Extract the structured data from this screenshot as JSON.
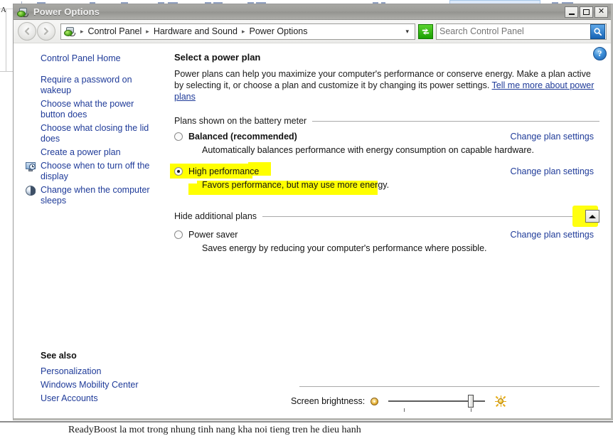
{
  "background": {
    "left_letter": "A",
    "bottom_text": "ReadyBoost la mot trong nhung tinh nang kha noi tieng tren he dieu hanh"
  },
  "window": {
    "title": "Power Options",
    "icon": "power-plug-icon",
    "minimize_label": "_",
    "maximize_label": "□",
    "close_label": "✕"
  },
  "toolbar": {
    "back_label": "Back",
    "forward_label": "Forward",
    "breadcrumbs": [
      "Control Panel",
      "Hardware and Sound",
      "Power Options"
    ],
    "breadcrumb_separator": "▸",
    "address_dropdown": "▾",
    "refresh_label": "Refresh",
    "search_placeholder": "Search Control Panel",
    "search_value": "",
    "search_button": "search-icon"
  },
  "help": {
    "label": "?"
  },
  "sidebar": {
    "home_link": "Control Panel Home",
    "items": [
      {
        "label": "Require a password on wakeup",
        "icon": null
      },
      {
        "label": "Choose what the power button does",
        "icon": null
      },
      {
        "label": "Choose what closing the lid does",
        "icon": null
      },
      {
        "label": "Create a power plan",
        "icon": null
      },
      {
        "label": "Choose when to turn off the display",
        "icon": "display-clock-icon"
      },
      {
        "label": "Change when the computer sleeps",
        "icon": "sleep-moon-icon"
      }
    ],
    "see_also": {
      "title": "See also",
      "links": [
        "Personalization",
        "Windows Mobility Center",
        "User Accounts"
      ]
    }
  },
  "main": {
    "title": "Select a power plan",
    "description_part1": "Power plans can help you maximize your computer's performance or conserve energy. Make a plan active by selecting it, or choose a plan and customize it by changing its power settings. ",
    "description_link": "Tell me more about power plans",
    "group_battery_label": "Plans shown on the battery meter",
    "group_hide_label": "Hide additional plans",
    "collapse_button_label": "▲",
    "change_settings_label": "Change plan settings",
    "plans": [
      {
        "name": "Balanced (recommended)",
        "description": "Automatically balances performance with energy consumption on capable hardware.",
        "selected": false,
        "bold": true,
        "highlighted": false,
        "change_link": "Change plan settings"
      },
      {
        "name": "High performance",
        "description": "Favors performance, but may use more energy.",
        "selected": true,
        "bold": false,
        "highlighted": true,
        "change_link": "Change plan settings"
      },
      {
        "name": "Power saver",
        "description": "Saves energy by reducing your computer's performance where possible.",
        "selected": false,
        "bold": false,
        "highlighted": false,
        "change_link": "Change plan settings"
      }
    ],
    "brightness": {
      "label": "Screen brightness:",
      "dim_icon": "sun-dim-icon",
      "bright_icon": "sun-bright-icon",
      "value_percent": 82
    }
  },
  "colors": {
    "highlight_yellow": "#ffff00",
    "link_blue": "#1f3b99",
    "titlebar_gray": "#9d9d99",
    "window_bg": "#ffffff"
  }
}
